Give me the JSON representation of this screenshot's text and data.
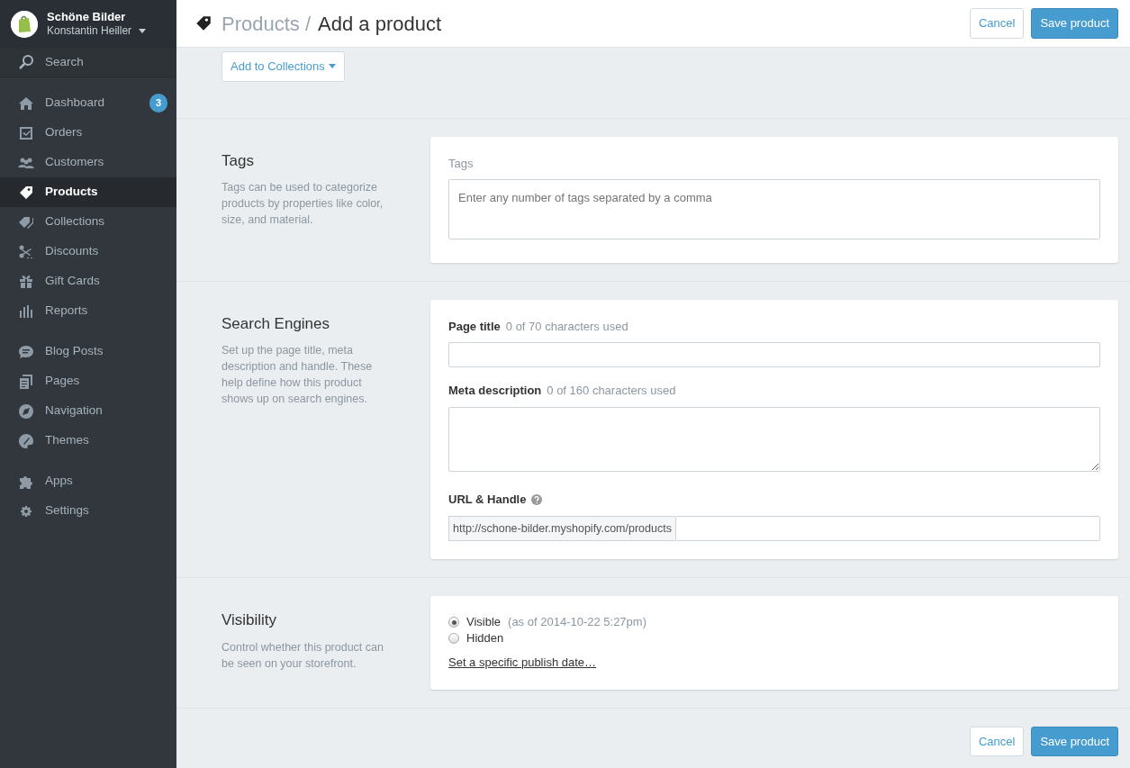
{
  "store": {
    "name": "Schöne Bilder",
    "user": "Konstantin Heiller"
  },
  "search": {
    "label": "Search"
  },
  "sidebar": {
    "groups": [
      {
        "items": [
          {
            "label": "Dashboard",
            "badge": "3",
            "selected": false
          },
          {
            "label": "Orders",
            "selected": false
          },
          {
            "label": "Customers",
            "selected": false
          },
          {
            "label": "Products",
            "selected": true
          },
          {
            "label": "Collections",
            "selected": false
          },
          {
            "label": "Discounts",
            "selected": false
          },
          {
            "label": "Gift Cards",
            "selected": false
          },
          {
            "label": "Reports",
            "selected": false
          }
        ]
      },
      {
        "items": [
          {
            "label": "Blog Posts",
            "selected": false
          },
          {
            "label": "Pages",
            "selected": false
          },
          {
            "label": "Navigation",
            "selected": false
          },
          {
            "label": "Themes",
            "selected": false
          }
        ]
      },
      {
        "items": [
          {
            "label": "Apps",
            "selected": false
          },
          {
            "label": "Settings",
            "selected": false
          }
        ]
      }
    ]
  },
  "header": {
    "breadcrumb": "Products /",
    "title": "Add a product",
    "buttons": [
      {
        "label": "Cancel",
        "kind": "default"
      },
      {
        "label": "Save product",
        "kind": "primary"
      }
    ]
  },
  "collections_button": "Add to Collections",
  "sections": [
    {
      "kind": "tags",
      "title": "Tags",
      "description": "Tags can be used to categorize products by properties like color, size, and material.",
      "label": "Tags",
      "placeholder": "Enter any number of tags separated by a comma"
    },
    {
      "kind": "seo",
      "title": "Search Engines",
      "description": "Set up the page title, meta description and handle. These help define how this product shows up on search engines.",
      "fields": [
        {
          "kind": "input",
          "label": "Page title",
          "hint": "0 of 70 characters used"
        },
        {
          "kind": "textarea",
          "label": "Meta description",
          "hint": "0 of 160 characters used"
        },
        {
          "kind": "url",
          "label": "URL & Handle",
          "prefix": "http://schone-bilder.myshopify.com/products"
        }
      ]
    },
    {
      "kind": "visibility",
      "title": "Visibility",
      "description": "Control whether this product can be seen on your storefront.",
      "options": [
        {
          "label": "Visible",
          "note": "(as of 2014-10-22 5:27pm)",
          "selected": true
        },
        {
          "label": "Hidden",
          "selected": false
        }
      ],
      "link": "Set a specific publish date…"
    }
  ],
  "footer_buttons": [
    {
      "label": "Cancel",
      "kind": "default"
    },
    {
      "label": "Save product",
      "kind": "primary"
    }
  ]
}
